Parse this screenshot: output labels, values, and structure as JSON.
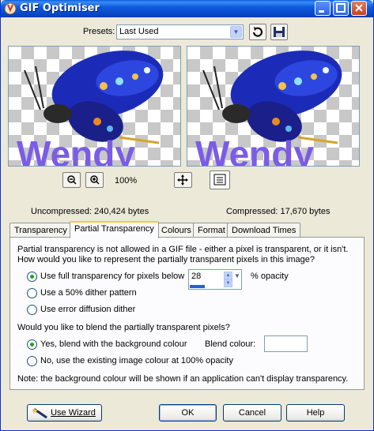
{
  "window": {
    "title": "GIF Optimiser"
  },
  "presets": {
    "label": "Presets:",
    "selected": "Last Used"
  },
  "previews": {
    "watermark_text": "Wendy"
  },
  "zoom": {
    "level": "100%"
  },
  "sizes": {
    "uncompressed": "Uncompressed:  240,424 bytes",
    "compressed": "Compressed: 17,670 bytes"
  },
  "tabs": [
    "Transparency",
    "Partial Transparency",
    "Colours",
    "Format",
    "Download Times"
  ],
  "active_tab": "Partial Transparency",
  "panel": {
    "intro_line1": "Partial transparency is not allowed in a GIF file - either a pixel is transparent, or it isn't.",
    "intro_line2": "How would you like to represent the partially transparent pixels in this image?",
    "option_full": "Use full transparency for pixels below",
    "opacity_value": "28",
    "opacity_suffix": "% opacity",
    "option_dither50": "Use a 50% dither pattern",
    "option_diffusion": "Use error diffusion dither",
    "blend_question": "Would you like to blend the partially transparent pixels?",
    "blend_yes": "Yes, blend with the background colour",
    "blend_colour_label": "Blend colour:",
    "blend_no": "No, use the existing image colour at 100% opacity",
    "note": "Note: the background colour will be shown if an application can't display transparency."
  },
  "buttons": {
    "wizard": "Use Wizard",
    "ok": "OK",
    "cancel": "Cancel",
    "help": "Help"
  },
  "colors": {
    "titlebar": "#0A5EDC",
    "dialog_bg": "#ECE9D8",
    "tab_accent": "#FFC83C",
    "text_purple": "#7B5CE6"
  }
}
